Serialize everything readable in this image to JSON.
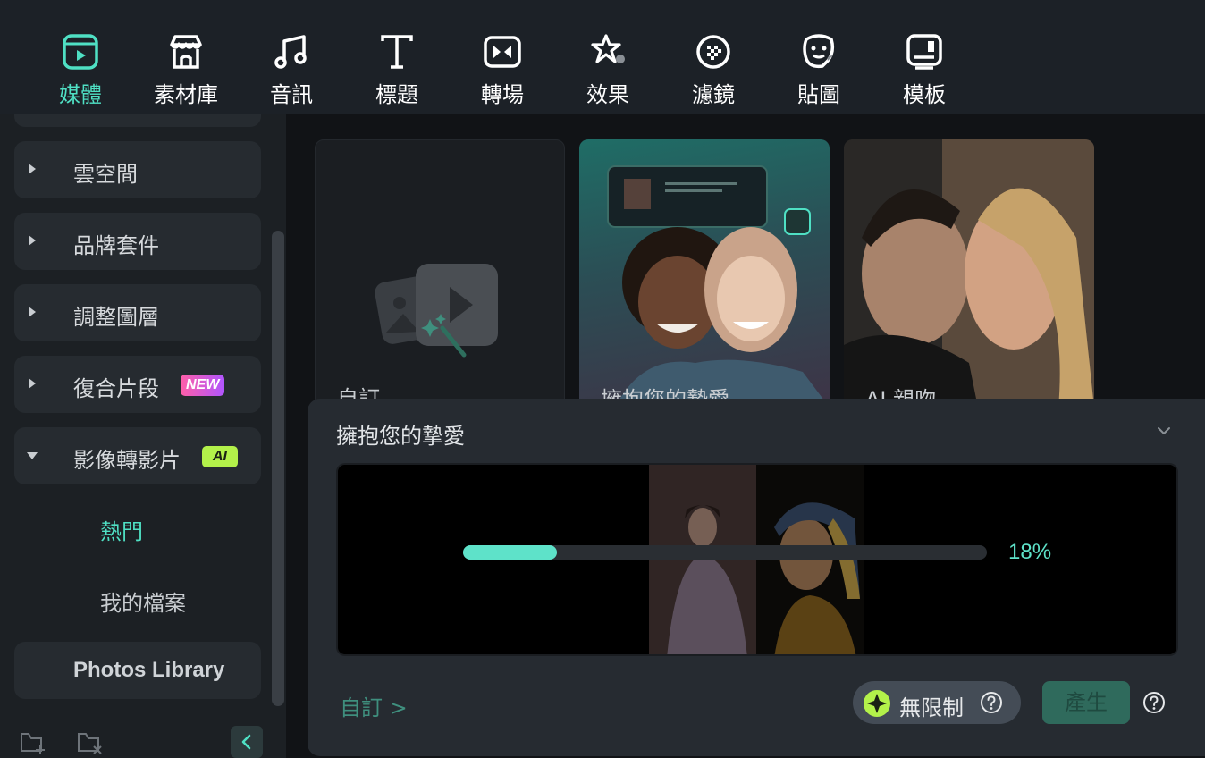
{
  "toolbar": {
    "items": [
      {
        "label": "媒體",
        "icon": "media-icon",
        "active": true
      },
      {
        "label": "素材庫",
        "icon": "store-icon",
        "active": false
      },
      {
        "label": "音訊",
        "icon": "music-note-icon",
        "active": false
      },
      {
        "label": "標題",
        "icon": "title-t-icon",
        "active": false
      },
      {
        "label": "轉場",
        "icon": "transition-icon",
        "active": false
      },
      {
        "label": "效果",
        "icon": "effects-star-icon",
        "active": false
      },
      {
        "label": "濾鏡",
        "icon": "filter-icon",
        "active": false
      },
      {
        "label": "貼圖",
        "icon": "sticker-icon",
        "active": false
      },
      {
        "label": "模板",
        "icon": "template-icon",
        "active": false
      }
    ]
  },
  "sidebar": {
    "items": [
      {
        "label": "雲空間",
        "expanded": false
      },
      {
        "label": "品牌套件",
        "expanded": false
      },
      {
        "label": "調整圖層",
        "expanded": false
      },
      {
        "label": "復合片段",
        "expanded": false,
        "badge": "NEW"
      },
      {
        "label": "影像轉影片",
        "expanded": true,
        "badge": "AI"
      }
    ],
    "subitems": [
      {
        "label": "熱門",
        "active": true
      },
      {
        "label": "我的檔案",
        "active": false
      }
    ],
    "photos_library": "Photos Library"
  },
  "cards": [
    {
      "title": "自訂"
    },
    {
      "title": "擁抱您的摯愛"
    },
    {
      "title": "AI 親吻"
    }
  ],
  "panel": {
    "title": "擁抱您的摯愛",
    "progress_percent": 18,
    "progress_text": "18%",
    "custom_link": "自訂 >",
    "unlimited_label": "無限制",
    "generate_label": "產生"
  },
  "colors": {
    "accent": "#4fe0c4",
    "progress": "#5ee2c9",
    "badge_ai": "#b3f14a"
  }
}
